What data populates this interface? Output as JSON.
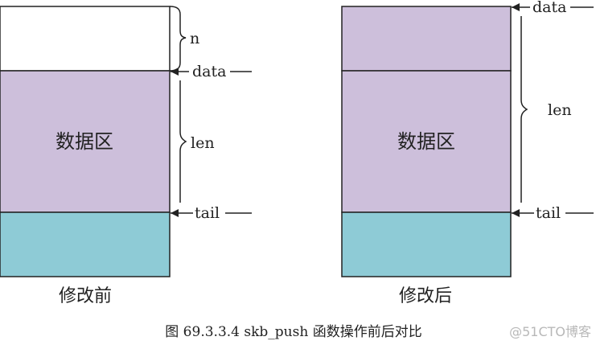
{
  "before": {
    "caption": "修改前",
    "region_label": "数据区",
    "labels": {
      "n": "n",
      "data": "data",
      "len": "len",
      "tail": "tail"
    }
  },
  "after": {
    "caption": "修改后",
    "region_label": "数据区",
    "labels": {
      "data": "data",
      "len": "len",
      "tail": "tail"
    }
  },
  "figure_caption": "图 69.3.3.4 skb_push 函数操作前后对比",
  "watermark": "@51CTO博客",
  "colors": {
    "headroom_before": "#ffffff",
    "data_region": "#cdbfdb",
    "tailroom": "#8ecbd6",
    "border": "#222222"
  }
}
